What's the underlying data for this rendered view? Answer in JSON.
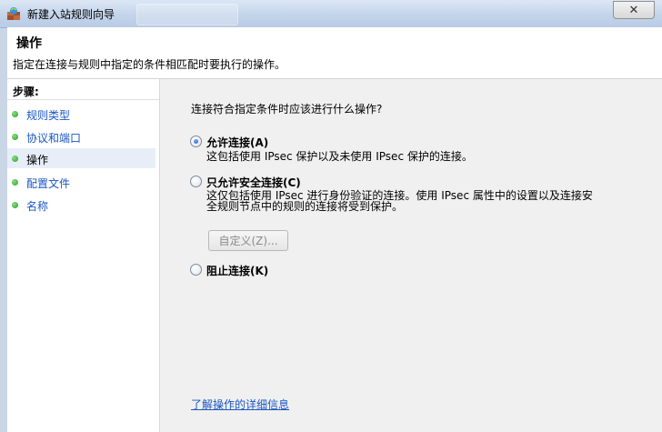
{
  "window": {
    "title": "新建入站规则向导",
    "close_glyph": "✕"
  },
  "header": {
    "title": "操作",
    "description": "指定在连接与规则中指定的条件相匹配时要执行的操作。"
  },
  "sidebar": {
    "heading": "步骤:",
    "items": [
      {
        "label": "规则类型"
      },
      {
        "label": "协议和端口"
      },
      {
        "label": "操作"
      },
      {
        "label": "配置文件"
      },
      {
        "label": "名称"
      }
    ],
    "active_index": 2
  },
  "main": {
    "question": "连接符合指定条件时应该进行什么操作?",
    "options": [
      {
        "label": "允许连接(A)",
        "description": "这包括使用 IPsec 保护以及未使用 IPsec 保护的连接。",
        "checked": true
      },
      {
        "label": "只允许安全连接(C)",
        "description_line1": "这仅包括使用 IPsec 进行身份验证的连接。使用 IPsec 属性中的设置以及连接安",
        "description_line2": "全规则节点中的规则的连接将受到保护。",
        "checked": false
      },
      {
        "label": "阻止连接(K)",
        "checked": false
      }
    ],
    "custom_button": "自定义(Z)...",
    "learn_more_link": "了解操作的详细信息"
  },
  "colors": {
    "link": "#1a56c4",
    "step_dot": "#1e9e2a",
    "titlebar": "#c3d4ea"
  }
}
